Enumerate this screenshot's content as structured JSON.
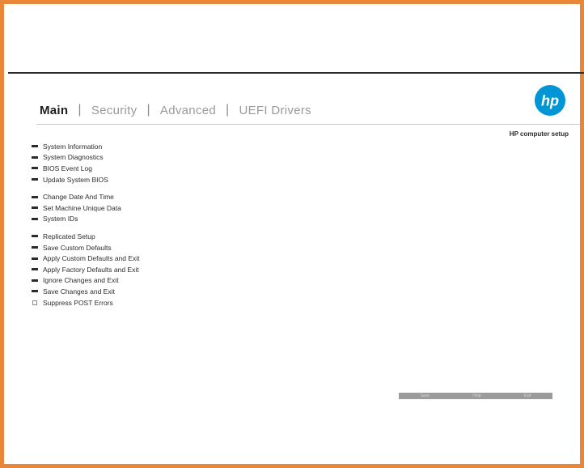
{
  "tabs": [
    {
      "label": "Main"
    },
    {
      "label": "Security"
    },
    {
      "label": "Advanced"
    },
    {
      "label": "UEFI Drivers"
    }
  ],
  "brand": {
    "logo_text": "hp",
    "subtitle": "HP computer setup",
    "logo_color": "#0096d6"
  },
  "menu": {
    "groups": [
      [
        {
          "label": "System Information"
        },
        {
          "label": "System Diagnostics"
        },
        {
          "label": "BIOS Event Log"
        },
        {
          "label": "Update System BIOS"
        }
      ],
      [
        {
          "label": "Change Date And Time"
        },
        {
          "label": "Set Machine Unique Data"
        },
        {
          "label": "System IDs"
        }
      ],
      [
        {
          "label": "Replicated Setup"
        },
        {
          "label": "Save Custom Defaults"
        },
        {
          "label": "Apply Custom Defaults and Exit"
        },
        {
          "label": "Apply Factory Defaults and Exit"
        },
        {
          "label": "Ignore Changes and Exit"
        },
        {
          "label": "Save Changes and Exit"
        },
        {
          "label": "Suppress POST Errors",
          "checkbox": true
        }
      ]
    ]
  },
  "footer": {
    "keys": [
      "Save",
      "Help",
      "Exit"
    ]
  },
  "colors": {
    "frame": "#e8873a",
    "active_tab": "#1e1e1e",
    "inactive_tab": "#9a9a9a"
  }
}
